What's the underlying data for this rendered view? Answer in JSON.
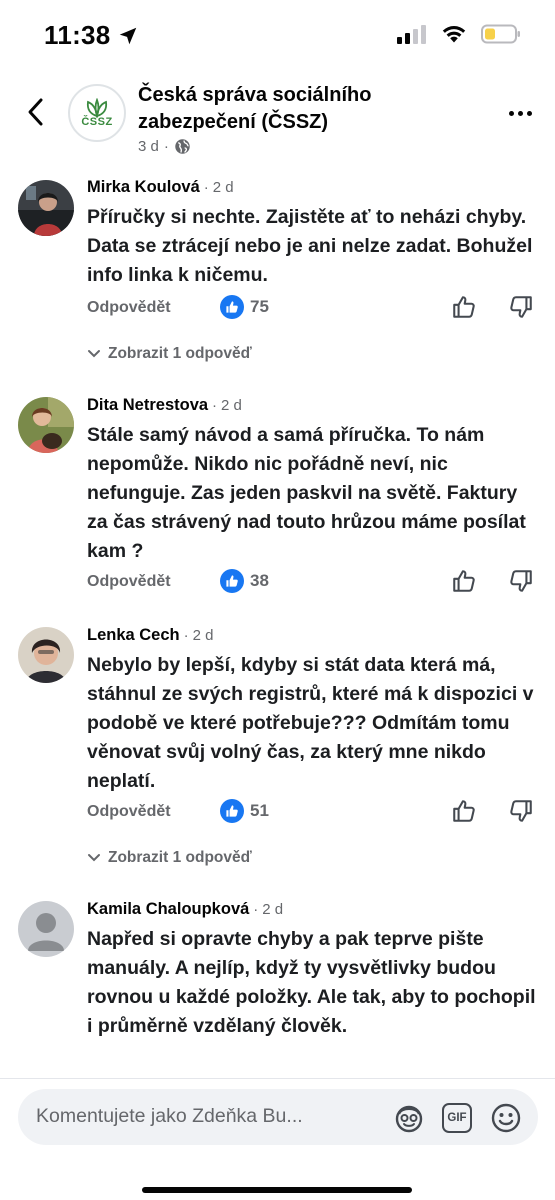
{
  "status_bar": {
    "time": "11:38"
  },
  "header": {
    "page_name": "Česká správa sociálního zabezpečení (ČSSZ)",
    "logo_text": "ČSSZ",
    "post_age": "3 d",
    "separator": "·"
  },
  "comments": [
    {
      "author": "Mirka Koulová",
      "time": "2 d",
      "text": "Příručky si nechte. Zajistěte ať to neházi chyby. Data se ztrácejí nebo je ani nelze zadat. Bohužel info linka k ničemu.",
      "reply_label": "Odpovědět",
      "likes": "75",
      "show_replies": "Zobrazit 1 odpověď"
    },
    {
      "author": "Dita Netrestova",
      "time": "2 d",
      "text": "Stále samý návod a samá příručka.  To nám nepomůže. Nikdo nic pořádně neví, nic nefunguje. Zas jeden paskvil na světě. Faktury za čas strávený nad touto hrůzou máme posílat kam ?",
      "reply_label": "Odpovědět",
      "likes": "38"
    },
    {
      "author": "Lenka Cech",
      "time": "2 d",
      "text": "Nebylo by lepší, kdyby si stát data která má, stáhnul ze svých registrů, které má k dispozici v podobě ve které potřebuje??? Odmítám tomu věnovat svůj volný čas, za který mne nikdo neplatí.",
      "reply_label": "Odpovědět",
      "likes": "51",
      "show_replies": "Zobrazit 1 odpověď"
    },
    {
      "author": "Kamila Chaloupková",
      "time": "2 d",
      "text": "Napřed si opravte chyby a pak teprve pište manuály. A nejlíp,  když ty vysvětlivky budou rovnou u každé položky.  Ale tak, aby to pochopil i průměrně vzdělaný člověk."
    }
  ],
  "composer": {
    "placeholder": "Komentujete jako Zdeňka Bu...",
    "gif_label": "GIF"
  },
  "colors": {
    "accent": "#1877f2",
    "secondary_text": "#65676b",
    "composer_bg": "#f0f2f5",
    "battery": "#f7d14a"
  }
}
